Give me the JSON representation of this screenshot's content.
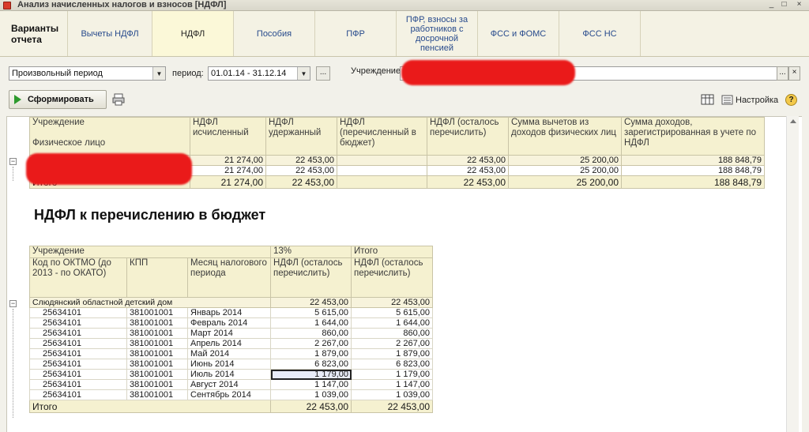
{
  "window": {
    "title": "Анализ начисленных налогов и взносов [НДФЛ]",
    "controls": [
      "_",
      "□",
      "×"
    ]
  },
  "tabs": [
    {
      "label": "Варианты отчета"
    },
    {
      "label": "Вычеты НДФЛ"
    },
    {
      "label": "НДФЛ"
    },
    {
      "label": "Пособия"
    },
    {
      "label": "ПФР"
    },
    {
      "label": "ПФР, взносы за работников с досрочной пенсией"
    },
    {
      "label": "ФСС и ФОМС"
    },
    {
      "label": "ФСС НС"
    }
  ],
  "filters": {
    "period_type": "Произвольный период",
    "period_label": "период:",
    "period_value": "01.01.14 - 31.12.14",
    "ellipsis": "...",
    "org_label": "Учреждение:",
    "org_value": ""
  },
  "toolbar": {
    "generate_label": "Сформировать",
    "settings_label": "Настройка",
    "help_label": "?"
  },
  "table1": {
    "headers": {
      "org": "Учреждение",
      "person": "Физическое лицо",
      "calc": "НДФЛ исчисленный",
      "withheld": "НДФЛ удержанный",
      "transferred": "НДФЛ (перечисленный в бюджет)",
      "remaining": "НДФЛ (осталось перечислить)",
      "deductions": "Сумма вычетов из доходов физических лиц",
      "income": "Сумма доходов, зарегистрированная в учете по НДФЛ"
    },
    "rows": [
      {
        "calc": "21 274,00",
        "withheld": "22 453,00",
        "transferred": "",
        "remaining": "22 453,00",
        "deductions": "25 200,00",
        "income": "188 848,79"
      },
      {
        "calc": "21 274,00",
        "withheld": "22 453,00",
        "transferred": "",
        "remaining": "22 453,00",
        "deductions": "25 200,00",
        "income": "188 848,79"
      }
    ],
    "total": {
      "label": "Итого",
      "calc": "21 274,00",
      "withheld": "22 453,00",
      "transferred": "",
      "remaining": "22 453,00",
      "deductions": "25 200,00",
      "income": "188 848,79"
    }
  },
  "section_title": "НДФЛ к перечислению в бюджет",
  "table2": {
    "headers": {
      "org": "Учреждение",
      "rate": "13%",
      "total_col": "Итого",
      "oktmo": "Код по ОКТМО (до 2013 - по ОКАТО)",
      "kpp": "КПП",
      "month": "Месяц налогового периода",
      "ndfl_rate": "НДФЛ (осталось перечислить)",
      "ndfl_total": "НДФЛ (осталось перечислить)"
    },
    "group": {
      "name": "Слюдянский областной детский дом",
      "rate": "22 453,00",
      "total": "22 453,00"
    },
    "rows": [
      {
        "oktmo": "25634101",
        "kpp": "381001001",
        "month": "Январь 2014",
        "rate": "5 615,00",
        "total": "5 615,00"
      },
      {
        "oktmo": "25634101",
        "kpp": "381001001",
        "month": "Февраль 2014",
        "rate": "1 644,00",
        "total": "1 644,00"
      },
      {
        "oktmo": "25634101",
        "kpp": "381001001",
        "month": "Март 2014",
        "rate": "860,00",
        "total": "860,00"
      },
      {
        "oktmo": "25634101",
        "kpp": "381001001",
        "month": "Апрель 2014",
        "rate": "2 267,00",
        "total": "2 267,00"
      },
      {
        "oktmo": "25634101",
        "kpp": "381001001",
        "month": "Май 2014",
        "rate": "1 879,00",
        "total": "1 879,00"
      },
      {
        "oktmo": "25634101",
        "kpp": "381001001",
        "month": "Июнь 2014",
        "rate": "6 823,00",
        "total": "6 823,00"
      },
      {
        "oktmo": "25634101",
        "kpp": "381001001",
        "month": "Июль 2014",
        "rate": "1 179,00",
        "total": "1 179,00"
      },
      {
        "oktmo": "25634101",
        "kpp": "381001001",
        "month": "Август 2014",
        "rate": "1 147,00",
        "total": "1 147,00"
      },
      {
        "oktmo": "25634101",
        "kpp": "381001001",
        "month": "Сентябрь 2014",
        "rate": "1 039,00",
        "total": "1 039,00"
      }
    ],
    "total": {
      "label": "Итого",
      "rate": "22 453,00",
      "total": "22 453,00"
    }
  },
  "colors": {
    "redaction": "#ea1a1a",
    "header_bg": "#f5f1d0",
    "tab_text": "#274a8c"
  }
}
